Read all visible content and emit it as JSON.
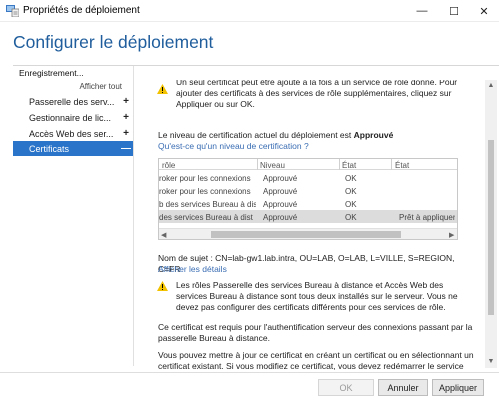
{
  "window": {
    "title": "Propriétés de déploiement",
    "controls": {
      "minimize": "—",
      "maximize": "☐",
      "close": "✕"
    }
  },
  "page": {
    "title": "Configurer le déploiement"
  },
  "sidebar": {
    "heading": "Enregistrement...",
    "show_all": "Afficher tout",
    "items": [
      {
        "label": "Passerelle des serv...",
        "toggle": "+"
      },
      {
        "label": "Gestionnaire de lic...",
        "toggle": "+"
      },
      {
        "label": "Accès Web des ser...",
        "toggle": "+"
      },
      {
        "label": "Certificats",
        "toggle": "—",
        "active": true
      }
    ]
  },
  "content": {
    "warning_top": "Un seul certificat peut être ajouté à la fois à un service de rôle donné. Pour ajouter des certificats à des services de rôle supplémentaires, cliquez sur Appliquer ou sur OK.",
    "cert_level_prefix": "Le niveau de certification actuel du déploiement est ",
    "cert_level_value": "Approuvé",
    "cert_level_link": "Qu'est-ce qu'un niveau de certification ?",
    "table": {
      "headers": [
        "rôle",
        "Niveau",
        "État",
        "État"
      ],
      "rows": [
        [
          "roker pour les connexions",
          "Approuvé",
          "OK",
          ""
        ],
        [
          "roker pour les connexions",
          "Approuvé",
          "OK",
          ""
        ],
        [
          "b des services Bureau à dist",
          "Approuvé",
          "OK",
          ""
        ],
        [
          "des services Bureau à dist",
          "Approuvé",
          "OK",
          "Prêt à appliquer"
        ]
      ],
      "selected_row": 3
    },
    "subject": "Nom de sujet : CN=lab-gw1.lab.intra, OU=LAB, O=LAB, L=VILLE, S=REGION, C=FR",
    "show_details": "Afficher les détails",
    "warning_roles": "Les rôles Passerelle des services Bureau à distance et Accès Web des services Bureau à distance sont tous deux installés sur le serveur. Vous ne devez pas configurer des certificats différents pour ces services de rôle.",
    "cert_required": "Ce certificat est requis pour l'authentification serveur des connexions passant par la passerelle Bureau à distance.",
    "update_info": "Vous pouvez mettre à jour ce certificat en créant un certificat ou en sélectionnant un certificat existant. Si vous modifiez ce certificat, vous devez redémarrer le service"
  },
  "footer": {
    "ok": "OK",
    "cancel": "Annuler",
    "apply": "Appliquer"
  },
  "colors": {
    "title_blue": "#1f5d9c",
    "active_item": "#2a74c9",
    "link": "#3a6db3",
    "warning": "#f2c200"
  },
  "icons": [
    "server-manager-icon",
    "warning-icon",
    "scroll-left-icon",
    "scroll-right-icon",
    "scroll-up-icon",
    "scroll-down-icon"
  ]
}
